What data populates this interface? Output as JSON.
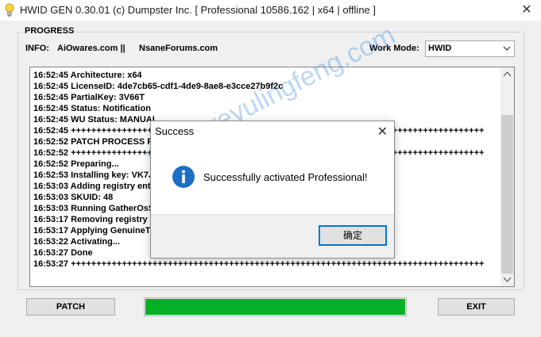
{
  "window": {
    "title": "HWID GEN 0.30.01 (c) Dumpster Inc. [ Professional 10586.162 | x64 | offline ]",
    "close_glyph": "✕"
  },
  "group": {
    "label": "PROGRESS"
  },
  "info": {
    "label": "INFO:",
    "item1": "AiOwares.com ||",
    "item2": "NsaneForums.com"
  },
  "work_mode": {
    "label": "Work Mode:",
    "value": "HWID"
  },
  "log": {
    "lines": [
      "16:52:45 Architecture: x64",
      "16:52:45 LicenseID: 4de7cb65-cdf1-4de9-8ae8-e3cce27b9f2c",
      "16:52:45 PartialKey: 3V66T",
      "16:52:45 Status: Notification",
      "16:52:45 WU Status: MANUAL",
      "16:52:45 +++++++++++++++++++++++++++++++++++++++++++++++++++++++++++++++++++++++++++++++++",
      "16:52:52 PATCH PROCESS PRE",
      "16:52:52 +++++++++++++++++++++++++++++++++++++++++++++++++++++++++++++++++++++++++++++++++",
      "16:52:52 Preparing...",
      "16:52:53 Installing key: VK7J",
      "16:53:03 Adding registry ent",
      "16:53:03 SKUID: 48",
      "16:53:03 Running GatherOsS",
      "16:53:17 Removing registry e",
      "16:53:17 Applying GenuineTi",
      "16:53:22 Activating...",
      "16:53:27 Done",
      "16:53:27 +++++++++++++++++++++++++++++++++++++++++++++++++++++++++++++++++++++++++++++++++"
    ]
  },
  "buttons": {
    "patch": "PATCH",
    "exit": "EXIT"
  },
  "progress": {
    "percent": 100,
    "color": "#06b025"
  },
  "dialog": {
    "title": "Success",
    "close_glyph": "✕",
    "message": "Successfully activated Professional!",
    "ok_label": "确定",
    "icon": "info-icon"
  },
  "watermark": "www.yeyulingfeng.com"
}
